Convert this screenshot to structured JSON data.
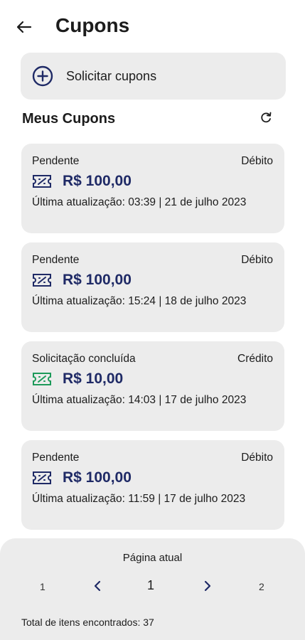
{
  "header": {
    "title": "Cupons",
    "back_icon": "arrow-left-icon"
  },
  "request": {
    "icon": "plus-circle-icon",
    "label": "Solicitar cupons"
  },
  "section": {
    "title": "Meus Cupons",
    "refresh_icon": "refresh-icon"
  },
  "colors": {
    "amount": "#1f2a66",
    "ticket_pending": "#1f2a66",
    "ticket_completed": "#1d9a5a",
    "card_bg": "#ececec"
  },
  "coupons": [
    {
      "status": "Pendente",
      "type": "Débito",
      "icon": "ticket-icon",
      "amount": "R$ 100,00",
      "updated": "Última atualização: 03:39 | 21 de julho 2023"
    },
    {
      "status": "Pendente",
      "type": "Débito",
      "icon": "ticket-icon",
      "amount": "R$ 100,00",
      "updated": "Última atualização: 15:24 | 18 de julho 2023"
    },
    {
      "status": "Solicitação concluída",
      "type": "Crédito",
      "icon": "ticket-icon",
      "amount": "R$ 10,00",
      "updated": "Última atualização: 14:03 | 17 de julho 2023"
    },
    {
      "status": "Pendente",
      "type": "Débito",
      "icon": "ticket-icon",
      "amount": "R$ 100,00",
      "updated": "Última atualização: 11:59 | 17 de julho 2023"
    }
  ],
  "pagination": {
    "label": "Página atual",
    "first": "1",
    "current": "1",
    "last": "2",
    "prev_icon": "chevron-left-icon",
    "next_icon": "chevron-right-icon",
    "total": "Total de itens encontrados: 37"
  }
}
